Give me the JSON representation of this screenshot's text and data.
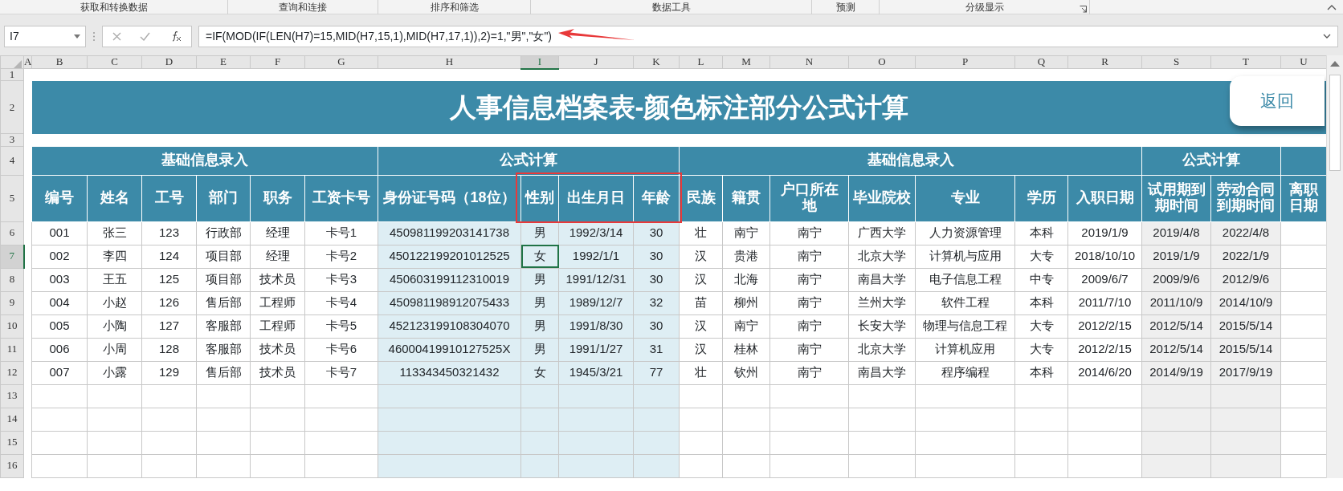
{
  "ribbon_groups": [
    {
      "label": "获取和转换数据",
      "launcher": false
    },
    {
      "label": "查询和连接",
      "launcher": false
    },
    {
      "label": "排序和筛选",
      "launcher": false
    },
    {
      "label": "数据工具",
      "launcher": false
    },
    {
      "label": "预测",
      "launcher": false
    },
    {
      "label": "分级显示",
      "launcher": true
    }
  ],
  "formula_bar": {
    "name_box": "I7",
    "formula": "=IF(MOD(IF(LEN(H7)=15,MID(H7,15,1),MID(H7,17,1)),2)=1,\"男\",\"女\")"
  },
  "column_headers": [
    {
      "label": "A",
      "selected": false
    },
    {
      "label": "B",
      "selected": false
    },
    {
      "label": "C",
      "selected": false
    },
    {
      "label": "D",
      "selected": false
    },
    {
      "label": "E",
      "selected": false
    },
    {
      "label": "F",
      "selected": false
    },
    {
      "label": "G",
      "selected": false
    },
    {
      "label": "H",
      "selected": false
    },
    {
      "label": "I",
      "selected": true
    },
    {
      "label": "J",
      "selected": false
    },
    {
      "label": "K",
      "selected": false
    },
    {
      "label": "L",
      "selected": false
    },
    {
      "label": "M",
      "selected": false
    },
    {
      "label": "N",
      "selected": false
    },
    {
      "label": "O",
      "selected": false
    },
    {
      "label": "P",
      "selected": false
    },
    {
      "label": "Q",
      "selected": false
    },
    {
      "label": "R",
      "selected": false
    },
    {
      "label": "S",
      "selected": false
    },
    {
      "label": "T",
      "selected": false
    },
    {
      "label": "U",
      "selected": false
    }
  ],
  "row_headers": [
    {
      "label": "1",
      "selected": false
    },
    {
      "label": "2",
      "selected": false
    },
    {
      "label": "3",
      "selected": false
    },
    {
      "label": "4",
      "selected": false
    },
    {
      "label": "5",
      "selected": false
    },
    {
      "label": "6",
      "selected": false
    },
    {
      "label": "7",
      "selected": true
    },
    {
      "label": "8",
      "selected": false
    },
    {
      "label": "9",
      "selected": false
    },
    {
      "label": "10",
      "selected": false
    },
    {
      "label": "11",
      "selected": false
    },
    {
      "label": "12",
      "selected": false
    },
    {
      "label": "13",
      "selected": false
    },
    {
      "label": "14",
      "selected": false
    },
    {
      "label": "15",
      "selected": false
    },
    {
      "label": "16",
      "selected": false
    }
  ],
  "sheet_title": "人事信息档案表-颜色标注部分公式计算",
  "return_button": "返回",
  "header_groups": [
    {
      "label": "基础信息录入",
      "kind": "input",
      "columns": [
        "编号",
        "姓名",
        "工号",
        "部门",
        "职务",
        "工资卡号"
      ]
    },
    {
      "label": "公式计算",
      "kind": "formula",
      "columns": [
        "身份证号码（18位）",
        "性别",
        "出生月日",
        "年龄"
      ]
    },
    {
      "label": "基础信息录入",
      "kind": "input",
      "columns": [
        "民族",
        "籍贯",
        "户口所在地",
        "毕业院校",
        "专业",
        "学历",
        "入职日期"
      ]
    },
    {
      "label": "公式计算",
      "kind": "calculated",
      "columns": [
        "试用期到期时间",
        "劳动合同到期时间"
      ]
    },
    {
      "kind": "input",
      "columns": [
        "离职日期"
      ]
    }
  ],
  "rows": [
    [
      "001",
      "张三",
      "123",
      "行政部",
      "经理",
      "卡号1",
      "450981199203141738",
      "男",
      "1992/3/14",
      "30",
      "壮",
      "南宁",
      "南宁",
      "广西大学",
      "人力资源管理",
      "本科",
      "2019/1/9",
      "2019/4/8",
      "2022/4/8"
    ],
    [
      "002",
      "李四",
      "124",
      "项目部",
      "经理",
      "卡号2",
      "450122199201012525",
      "女",
      "1992/1/1",
      "30",
      "汉",
      "贵港",
      "南宁",
      "北京大学",
      "计算机与应用",
      "大专",
      "2018/10/10",
      "2019/1/9",
      "2022/1/9"
    ],
    [
      "003",
      "王五",
      "125",
      "项目部",
      "技术员",
      "卡号3",
      "450603199112310019",
      "男",
      "1991/12/31",
      "30",
      "汉",
      "北海",
      "南宁",
      "南昌大学",
      "电子信息工程",
      "中专",
      "2009/6/7",
      "2009/9/6",
      "2012/9/6"
    ],
    [
      "004",
      "小赵",
      "126",
      "售后部",
      "工程师",
      "卡号4",
      "450981198912075433",
      "男",
      "1989/12/7",
      "32",
      "苗",
      "柳州",
      "南宁",
      "兰州大学",
      "软件工程",
      "本科",
      "2011/7/10",
      "2011/10/9",
      "2014/10/9"
    ],
    [
      "005",
      "小陶",
      "127",
      "客服部",
      "工程师",
      "卡号5",
      "452123199108304070",
      "男",
      "1991/8/30",
      "30",
      "汉",
      "南宁",
      "南宁",
      "长安大学",
      "物理与信息工程",
      "大专",
      "2012/2/15",
      "2012/5/14",
      "2015/5/14"
    ],
    [
      "006",
      "小周",
      "128",
      "客服部",
      "技术员",
      "卡号6",
      "46000419910127525X",
      "男",
      "1991/1/27",
      "31",
      "汉",
      "桂林",
      "南宁",
      "北京大学",
      "计算机应用",
      "大专",
      "2012/2/15",
      "2012/5/14",
      "2015/5/14"
    ],
    [
      "007",
      "小露",
      "129",
      "售后部",
      "技术员",
      "卡号7",
      "113343450321432",
      "女",
      "1945/3/21",
      "77",
      "壮",
      "钦州",
      "南宁",
      "南昌大学",
      "程序编程",
      "本科",
      "2014/6/20",
      "2014/9/19",
      "2017/9/19"
    ]
  ]
}
